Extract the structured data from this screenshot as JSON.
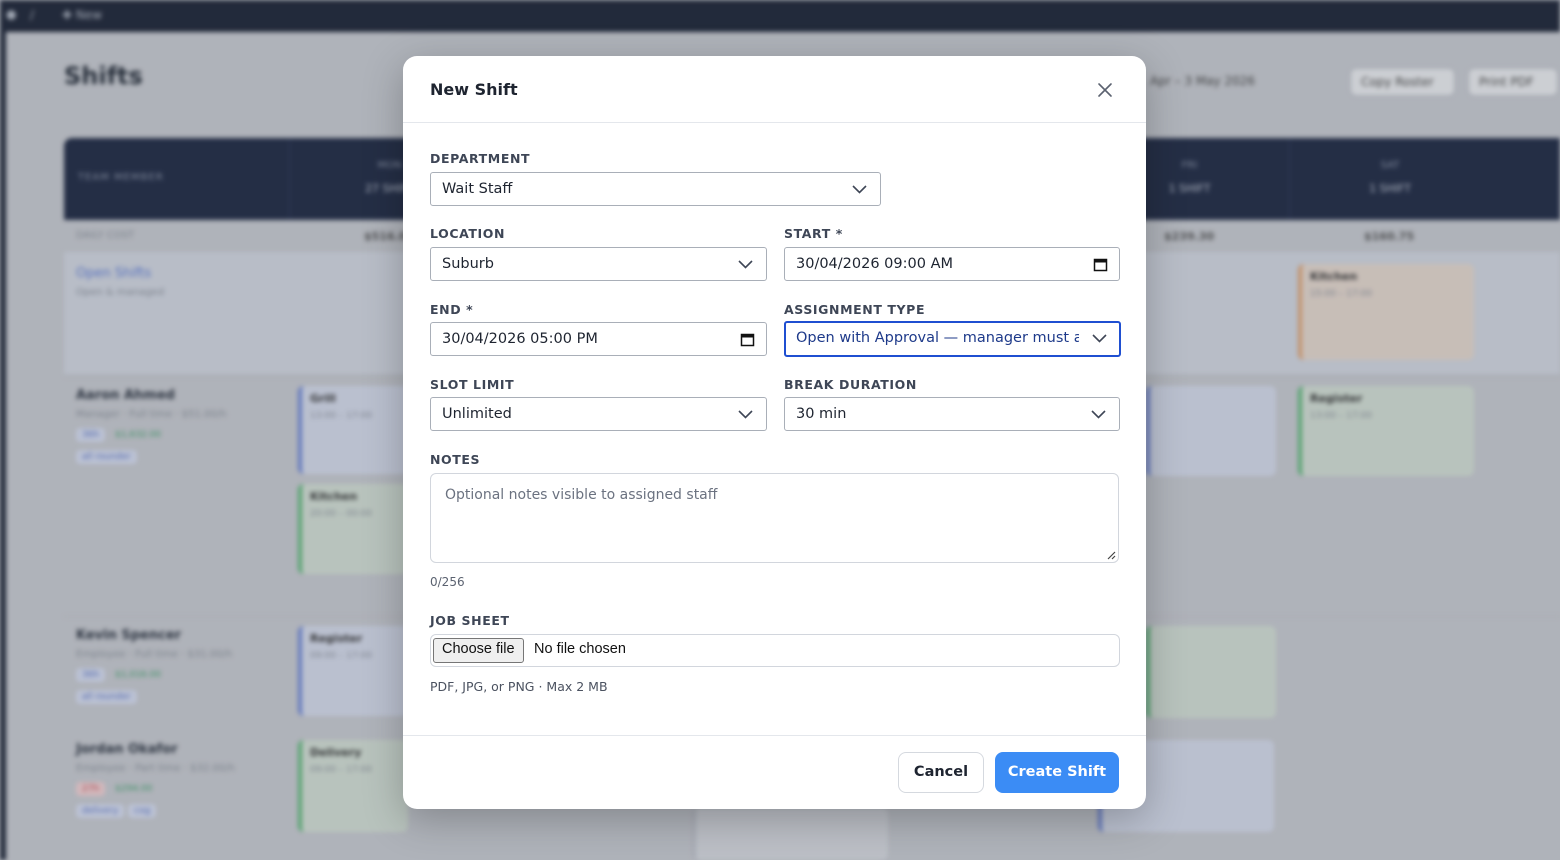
{
  "background": {
    "topbar": {
      "logo": "⬢",
      "separator": "/",
      "new_label": "✚ New"
    },
    "page_title": "Shifts",
    "header_controls": {
      "date_range": "Apr – 3 May 2026",
      "copy_roster": "Copy Roster",
      "print_pdf": "Print PDF"
    },
    "grid_header": {
      "team_label": "TEAM MEMBER",
      "days": [
        {
          "name": "MON",
          "count": "27 SHIFT"
        },
        {
          "name": "",
          "count": ""
        },
        {
          "name": "",
          "count": ""
        },
        {
          "name": "",
          "count": ""
        },
        {
          "name": "FRI",
          "count": "1 SHIFT"
        },
        {
          "name": "SAT",
          "count": "1 SHIFT"
        }
      ]
    },
    "cost_row": {
      "label": "DAILY COST",
      "values": [
        "$516.00",
        "$239.30",
        "$160.75"
      ]
    },
    "open_shifts": {
      "title": "Open Shifts",
      "subtitle": "Open & managed"
    },
    "members": [
      {
        "name": "Aaron Ahmed",
        "sub": "Manager · Full time · $51.00/h",
        "hours": "36h",
        "cost": "$1,632.00",
        "tag": "all rounder"
      },
      {
        "name": "Kevin Spencer",
        "sub": "Employee · Full time · $31.00/h",
        "hours": "36h",
        "cost": "$1,016.00",
        "tag": "all rounder"
      },
      {
        "name": "Jordan Okafor",
        "sub": "Employee · Part time · $32.00/h",
        "hours": "27h",
        "cost": "$294.00",
        "tag": "delivery",
        "tag2": "cog"
      }
    ],
    "cards": [
      {
        "title": "Kitchen",
        "sub": "15:00 – 17:00"
      },
      {
        "title": "Grill",
        "sub": "13:00 – 17:00"
      },
      {
        "title": "Register",
        "sub": "13:00 – 17:00"
      },
      {
        "title": "Kitchen",
        "sub": "20:00 – 00:00"
      },
      {
        "title": "Register",
        "sub": "09:00 – 17:00"
      },
      {
        "title": "Delivery",
        "sub": "09:00 – 17:00"
      }
    ]
  },
  "modal": {
    "title": "New Shift",
    "department": {
      "label": "DEPARTMENT",
      "value": "Wait Staff"
    },
    "location": {
      "label": "LOCATION",
      "value": "Suburb"
    },
    "start": {
      "label": "START *",
      "value": "30/04/2026 09:00 AM"
    },
    "end": {
      "label": "END *",
      "value": "30/04/2026 05:00 PM"
    },
    "assignment_type": {
      "label": "ASSIGNMENT TYPE",
      "value": "Open with Approval — manager must approve"
    },
    "slot_limit": {
      "label": "SLOT LIMIT",
      "value": "Unlimited"
    },
    "break_duration": {
      "label": "BREAK DURATION",
      "value": "30 min"
    },
    "notes": {
      "label": "NOTES",
      "placeholder": "Optional notes visible to assigned staff",
      "counter": "0/256"
    },
    "job_sheet": {
      "label": "JOB SHEET",
      "button": "Choose file",
      "status": "No file chosen",
      "hint": "PDF, JPG, or PNG · Max 2 MB"
    },
    "buttons": {
      "cancel": "Cancel",
      "create": "Create Shift"
    }
  },
  "colors": {
    "primary": "#3b8cf5",
    "focus": "#1f4fd1",
    "nav_dark": "#1d2537"
  }
}
